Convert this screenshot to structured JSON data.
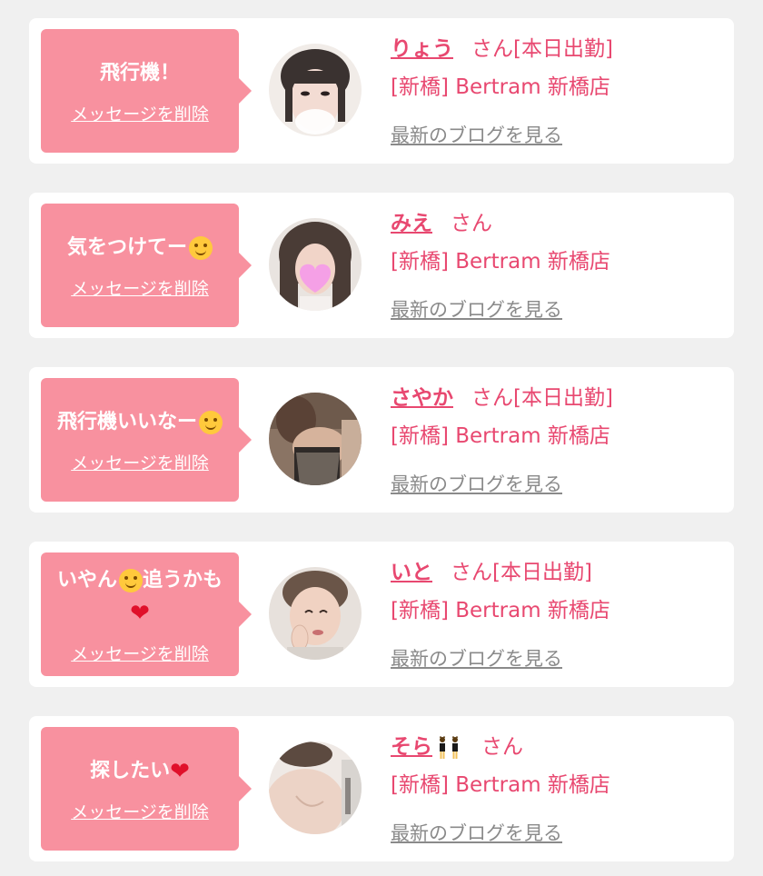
{
  "delete_label": "メッセージを削除",
  "blog_label": "最新のブログを見る",
  "colors": {
    "background": "#f0f0f0",
    "card": "#ffffff",
    "bubble": "#f8919f",
    "accent": "#e84870",
    "link_gray": "#8a8a8a"
  },
  "messages": [
    {
      "text": "飛行機！",
      "name": "りょう",
      "suffix": "さん[本日出勤]",
      "shop": "[新橋] Bertram 新橋店"
    },
    {
      "text": "気をつけてー",
      "text_emoji": "smiling-face-icon",
      "name": "みえ",
      "suffix": "さん",
      "shop": "[新橋] Bertram 新橋店"
    },
    {
      "text": "飛行機いいなー",
      "text_emoji": "smiling-face-icon",
      "name": "さやか",
      "suffix": "さん[本日出勤]",
      "shop": "[新橋] Bertram 新橋店"
    },
    {
      "text_a": "いやん",
      "text_b": "追うかも",
      "text_emoji": "smiling-face-icon",
      "text_emoji_2": "red-heart-icon",
      "name": "いと",
      "suffix": "さん[本日出勤]",
      "shop": "[新橋] Bertram 新橋店"
    },
    {
      "text": "探したい",
      "text_emoji": "red-heart-icon",
      "name": "そら",
      "name_emoji": "dancers-icon",
      "suffix": "さん",
      "shop": "[新橋] Bertram 新橋店"
    }
  ]
}
